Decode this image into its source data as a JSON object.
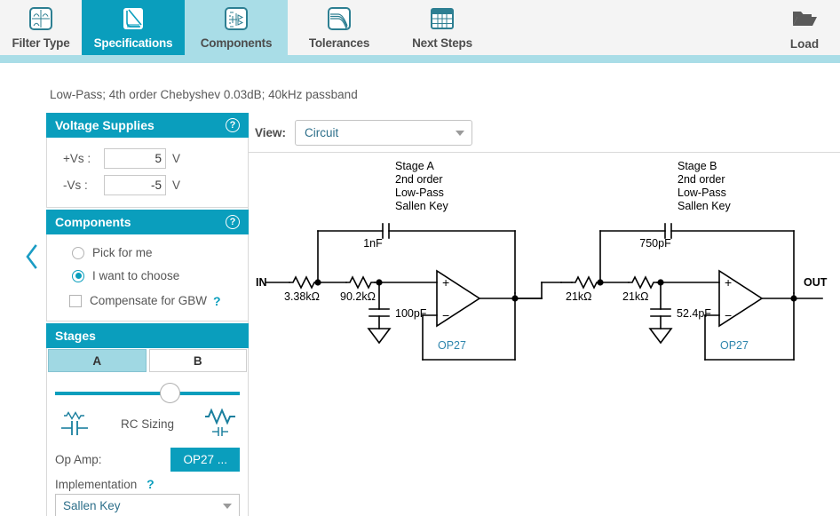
{
  "tabs": [
    {
      "label": "Filter Type",
      "icon": "filter-type-icon",
      "state": "normal"
    },
    {
      "label": "Specifications",
      "icon": "specifications-icon",
      "state": "active"
    },
    {
      "label": "Components",
      "icon": "components-icon",
      "state": "hover"
    },
    {
      "label": "Tolerances",
      "icon": "tolerances-icon",
      "state": "normal"
    },
    {
      "label": "Next Steps",
      "icon": "next-steps-icon",
      "state": "normal"
    }
  ],
  "toolbar": {
    "load_label": "Load",
    "load_icon": "open-folder-icon"
  },
  "subtitle": "Low-Pass; 4th order Chebyshev 0.03dB; 40kHz passband",
  "colors": {
    "accent": "#0a9ebd",
    "accent_light": "#a9dde7",
    "stage_selected": "#a0d8e3",
    "link_text": "#2d6f8a",
    "panel_border": "#d8d8d8"
  },
  "sidebar": {
    "collapse_icon": "chevron-left-icon",
    "voltage_supplies": {
      "title": "Voltage Supplies",
      "help_icon": "help-circle-icon",
      "rows": [
        {
          "label": "+Vs :",
          "value": "5",
          "unit": "V"
        },
        {
          "label": "-Vs :",
          "value": "-5",
          "unit": "V"
        }
      ]
    },
    "components": {
      "title": "Components",
      "help_icon": "help-circle-icon",
      "options": [
        {
          "label": "Pick for me",
          "selected": false
        },
        {
          "label": "I want to choose",
          "selected": true
        }
      ],
      "checkbox": {
        "label": "Compensate for GBW",
        "checked": false,
        "help_icon": "help-question-icon"
      }
    },
    "stages": {
      "title": "Stages",
      "tabs": [
        {
          "label": "A",
          "selected": true
        },
        {
          "label": "B",
          "selected": false
        }
      ],
      "rc_sizing": {
        "label": "RC Sizing",
        "left_icon": "small-resistor-large-cap-icon",
        "right_icon": "large-resistor-small-cap-icon",
        "position_percent": 57
      },
      "op_amp": {
        "label": "Op Amp:",
        "button_label": "OP27 ..."
      },
      "implementation": {
        "label": "Implementation",
        "help_icon": "help-question-icon",
        "value": "Sallen Key"
      }
    }
  },
  "main": {
    "view": {
      "label": "View:",
      "value": "Circuit",
      "caret_icon": "chevron-down-icon"
    }
  },
  "circuit": {
    "input_label": "IN",
    "output_label": "OUT",
    "stages": [
      {
        "title_lines": [
          "Stage A",
          "2nd order",
          "Low-Pass",
          "Sallen Key"
        ],
        "r1": "3.38kΩ",
        "r2": "90.2kΩ",
        "c_feedback": "1nF",
        "c_ground": "100pF",
        "opamp": "OP27",
        "opamp_plus": "+",
        "opamp_minus": "−"
      },
      {
        "title_lines": [
          "Stage B",
          "2nd order",
          "Low-Pass",
          "Sallen Key"
        ],
        "r1": "21kΩ",
        "r2": "21kΩ",
        "c_feedback": "750pF",
        "c_ground": "52.4pF",
        "opamp": "OP27",
        "opamp_plus": "+",
        "opamp_minus": "−"
      }
    ]
  }
}
